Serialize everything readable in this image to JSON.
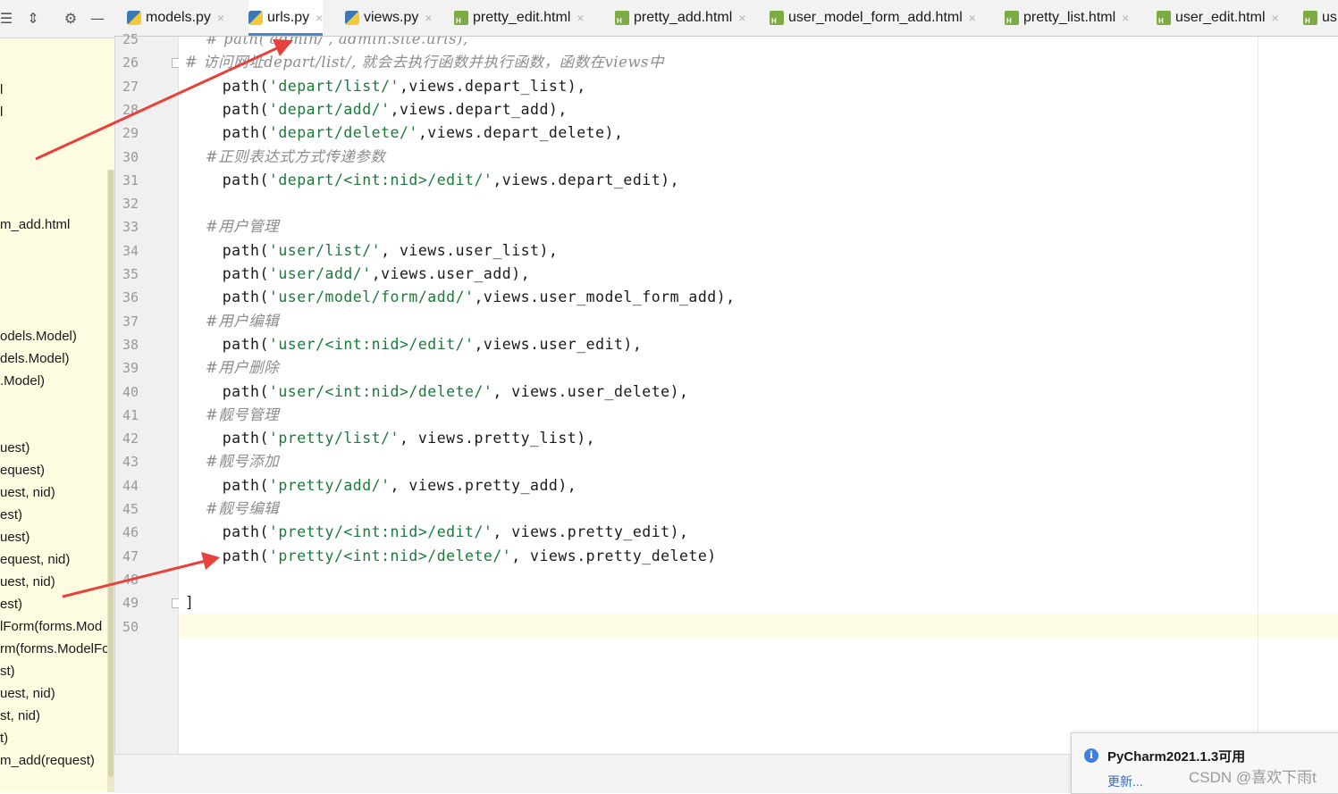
{
  "left_panel": {
    "items": [
      "l",
      "l",
      "m_add.html",
      "odels.Model)",
      "dels.Model)",
      ".Model)",
      "uest)",
      "equest)",
      "uest, nid)",
      "est)",
      "uest)",
      "equest, nid)",
      "uest, nid)",
      "est)",
      "lForm(forms.Mod",
      "rm(forms.ModelFo",
      "st)",
      "uest, nid)",
      "st, nid)",
      "t)",
      "m_add(request)"
    ]
  },
  "tabs": [
    {
      "label": "models.py",
      "type": "py",
      "active": false
    },
    {
      "label": "urls.py",
      "type": "py",
      "active": true
    },
    {
      "label": "views.py",
      "type": "py",
      "active": false
    },
    {
      "label": "pretty_edit.html",
      "type": "html",
      "active": false
    },
    {
      "label": "pretty_add.html",
      "type": "html",
      "active": false
    },
    {
      "label": "user_model_form_add.html",
      "type": "html",
      "active": false
    },
    {
      "label": "pretty_list.html",
      "type": "html",
      "active": false
    },
    {
      "label": "user_edit.html",
      "type": "html",
      "active": false
    },
    {
      "label": "us",
      "type": "html",
      "active": false
    }
  ],
  "editor": {
    "lines": [
      {
        "no": "25",
        "parts": [
          {
            "t": "    # path('admin/', admin.site.urls),",
            "c": "cm"
          }
        ]
      },
      {
        "no": "26",
        "parts": [
          {
            "t": "# 访问网址depart/list/, 就会去执行函数并执行函数，函数在views中",
            "c": "cm"
          }
        ]
      },
      {
        "no": "27",
        "parts": [
          {
            "t": "    path(",
            "c": "fn"
          },
          {
            "t": "'depart/list/'",
            "c": "str"
          },
          {
            "t": ",views.depart_list),",
            "c": "fn"
          }
        ]
      },
      {
        "no": "28",
        "parts": [
          {
            "t": "    path(",
            "c": "fn"
          },
          {
            "t": "'depart/add/'",
            "c": "str"
          },
          {
            "t": ",views.depart_add),",
            "c": "fn"
          }
        ]
      },
      {
        "no": "29",
        "parts": [
          {
            "t": "    path(",
            "c": "fn"
          },
          {
            "t": "'depart/delete/'",
            "c": "str"
          },
          {
            "t": ",views.depart_delete),",
            "c": "fn"
          }
        ]
      },
      {
        "no": "30",
        "parts": [
          {
            "t": "    #正则表达式方式传递参数",
            "c": "cm"
          }
        ]
      },
      {
        "no": "31",
        "parts": [
          {
            "t": "    path(",
            "c": "fn"
          },
          {
            "t": "'depart/<int:nid>/edit/'",
            "c": "str"
          },
          {
            "t": ",views.depart_edit),",
            "c": "fn"
          }
        ]
      },
      {
        "no": "32",
        "parts": []
      },
      {
        "no": "33",
        "parts": [
          {
            "t": "    #用户管理",
            "c": "cm"
          }
        ]
      },
      {
        "no": "34",
        "parts": [
          {
            "t": "    path(",
            "c": "fn"
          },
          {
            "t": "'user/list/'",
            "c": "str"
          },
          {
            "t": ", views.user_list),",
            "c": "fn"
          }
        ]
      },
      {
        "no": "35",
        "parts": [
          {
            "t": "    path(",
            "c": "fn"
          },
          {
            "t": "'user/add/'",
            "c": "str"
          },
          {
            "t": ",views.user_add),",
            "c": "fn"
          }
        ]
      },
      {
        "no": "36",
        "parts": [
          {
            "t": "    path(",
            "c": "fn"
          },
          {
            "t": "'user/model/form/add/'",
            "c": "str"
          },
          {
            "t": ",views.user_model_form_add),",
            "c": "fn"
          }
        ]
      },
      {
        "no": "37",
        "parts": [
          {
            "t": "    #用户编辑",
            "c": "cm"
          }
        ]
      },
      {
        "no": "38",
        "parts": [
          {
            "t": "    path(",
            "c": "fn"
          },
          {
            "t": "'user/<int:nid>/edit/'",
            "c": "str"
          },
          {
            "t": ",views.user_edit),",
            "c": "fn"
          }
        ]
      },
      {
        "no": "39",
        "parts": [
          {
            "t": "    #用户删除",
            "c": "cm"
          }
        ]
      },
      {
        "no": "40",
        "parts": [
          {
            "t": "    path(",
            "c": "fn"
          },
          {
            "t": "'user/<int:nid>/delete/'",
            "c": "str"
          },
          {
            "t": ", views.user_delete),",
            "c": "fn"
          }
        ]
      },
      {
        "no": "41",
        "parts": [
          {
            "t": "    #靓号管理",
            "c": "cm"
          }
        ]
      },
      {
        "no": "42",
        "parts": [
          {
            "t": "    path(",
            "c": "fn"
          },
          {
            "t": "'pretty/list/'",
            "c": "str"
          },
          {
            "t": ", views.pretty_list),",
            "c": "fn"
          }
        ]
      },
      {
        "no": "43",
        "parts": [
          {
            "t": "    #靓号添加",
            "c": "cm"
          }
        ]
      },
      {
        "no": "44",
        "parts": [
          {
            "t": "    path(",
            "c": "fn"
          },
          {
            "t": "'pretty/add/'",
            "c": "str"
          },
          {
            "t": ", views.pretty_add),",
            "c": "fn"
          }
        ]
      },
      {
        "no": "45",
        "parts": [
          {
            "t": "    #靓号编辑",
            "c": "cm"
          }
        ]
      },
      {
        "no": "46",
        "parts": [
          {
            "t": "    path(",
            "c": "fn"
          },
          {
            "t": "'pretty/<int:nid>/edit/'",
            "c": "str"
          },
          {
            "t": ", views.pretty_edit),",
            "c": "fn"
          }
        ]
      },
      {
        "no": "47",
        "parts": [
          {
            "t": "    path(",
            "c": "fn"
          },
          {
            "t": "'pretty/<int:nid>/delete/'",
            "c": "str"
          },
          {
            "t": ", views.pretty_delete)",
            "c": "fn"
          }
        ]
      },
      {
        "no": "48",
        "parts": []
      },
      {
        "no": "49",
        "parts": [
          {
            "t": "]",
            "c": "fn"
          }
        ]
      },
      {
        "no": "50",
        "parts": []
      }
    ]
  },
  "notification": {
    "title": "PyCharm2021.1.3可用",
    "link": "更新..."
  },
  "watermark": "CSDN @喜欢下雨t",
  "colors": {
    "string": "#1a7a3a",
    "comment": "#8c8c8c",
    "arrow": "#e8403a",
    "tab_underline": "#4a88c7"
  }
}
